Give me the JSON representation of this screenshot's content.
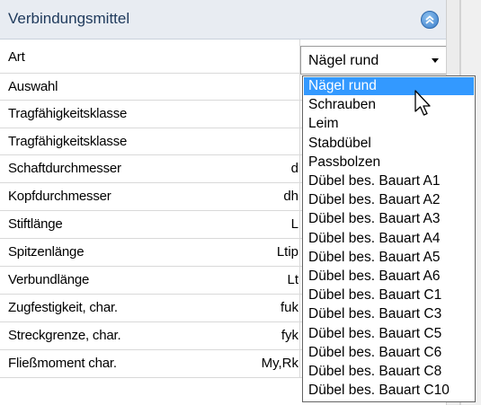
{
  "header": {
    "title": "Verbindungsmittel"
  },
  "rows": [
    {
      "label": "Art",
      "symbol": ""
    },
    {
      "label": "Auswahl",
      "symbol": ""
    },
    {
      "label": "Tragfähigkeitsklasse",
      "symbol": ""
    },
    {
      "label": "Tragfähigkeitsklasse",
      "symbol": ""
    },
    {
      "label": "Schaftdurchmesser",
      "symbol": "d"
    },
    {
      "label": "Kopfdurchmesser",
      "symbol": "dh"
    },
    {
      "label": "Stiftlänge",
      "symbol": "L"
    },
    {
      "label": "Spitzenlänge",
      "symbol": "Ltip"
    },
    {
      "label": "Verbundlänge",
      "symbol": "Lt"
    },
    {
      "label": "Zugfestigkeit, char.",
      "symbol": "fuk"
    },
    {
      "label": "Streckgrenze, char.",
      "symbol": "fyk"
    },
    {
      "label": "Fließmoment char.",
      "symbol": "My,Rk"
    }
  ],
  "combo": {
    "value": "Nägel rund"
  },
  "dropdown": {
    "selected_index": 0,
    "options": [
      "Nägel rund",
      "Schrauben",
      "Leim",
      "Stabdübel",
      "Passbolzen",
      "Dübel bes. Bauart A1",
      "Dübel bes. Bauart A2",
      "Dübel bes. Bauart A3",
      "Dübel bes. Bauart A4",
      "Dübel bes. Bauart A5",
      "Dübel bes. Bauart A6",
      "Dübel bes. Bauart C1",
      "Dübel bes. Bauart C3",
      "Dübel bes. Bauart C5",
      "Dübel bes. Bauart C6",
      "Dübel bes. Bauart C8",
      "Dübel bes. Bauart C10"
    ]
  },
  "colors": {
    "header_bg": "#e8ecf2",
    "header_text": "#1e395b",
    "selection": "#3399ff"
  }
}
